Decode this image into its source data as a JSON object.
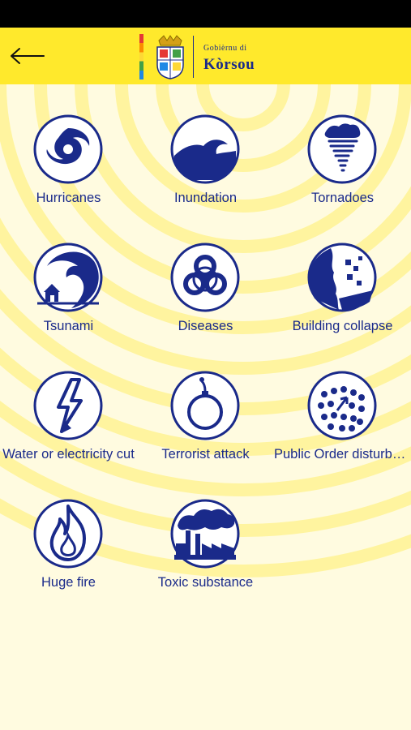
{
  "header": {
    "logo_line1": "Gobièrnu di",
    "logo_line2": "Kòrsou"
  },
  "icons": {
    "back": "arrow-left-icon",
    "crest": "coat-of-arms-icon"
  },
  "colors": {
    "appbar": "#ffe92c",
    "background": "#fffbe0",
    "accent": "#1a2a8a"
  },
  "items": [
    {
      "label": "Hurricanes",
      "icon": "hurricane-icon"
    },
    {
      "label": "Inundation",
      "icon": "wave-icon"
    },
    {
      "label": "Tornadoes",
      "icon": "tornado-icon"
    },
    {
      "label": "Tsunami",
      "icon": "tsunami-icon"
    },
    {
      "label": "Diseases",
      "icon": "biohazard-icon"
    },
    {
      "label": "Building collapse",
      "icon": "building-collapse-icon"
    },
    {
      "label": "Water or electricity cut",
      "icon": "lightning-icon"
    },
    {
      "label": "Terrorist attack",
      "icon": "bomb-icon"
    },
    {
      "label": "Public Order disturbance",
      "icon": "crowd-icon"
    },
    {
      "label": "Huge fire",
      "icon": "fire-icon"
    },
    {
      "label": "Toxic substance",
      "icon": "factory-smoke-icon"
    }
  ]
}
